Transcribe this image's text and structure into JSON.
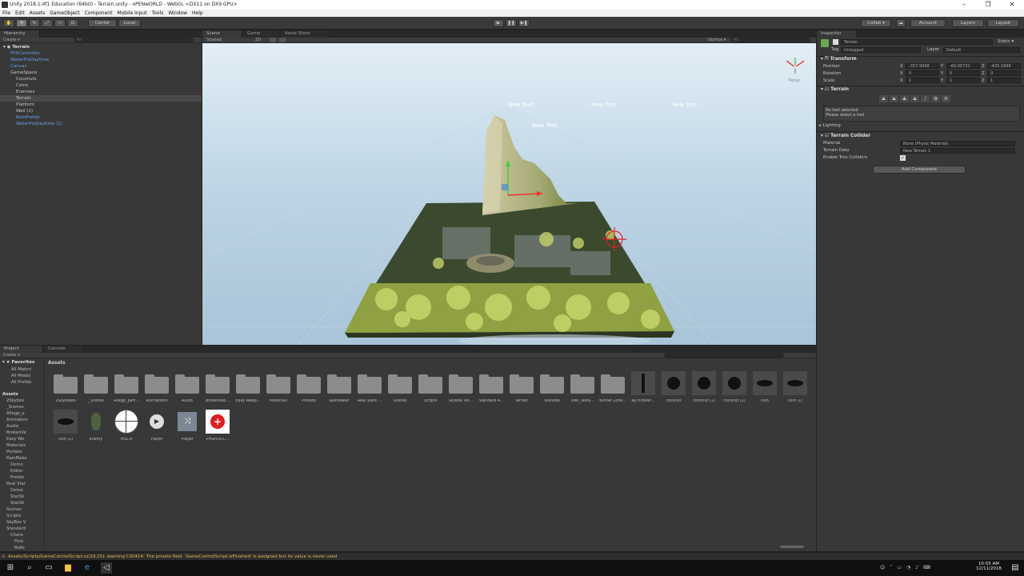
{
  "window": {
    "title": "Unity 2018.1.4f1 Education (64bit) - Terrain.unity - oPENwORLD - WebGL <DX11 on DX9 GPU>",
    "minimize": "–",
    "maximize": "❐",
    "close": "✕"
  },
  "menu": [
    "File",
    "Edit",
    "Assets",
    "GameObject",
    "Component",
    "Mobile Input",
    "Tools",
    "Window",
    "Help"
  ],
  "toolbar": {
    "center": "Center",
    "local": "Local",
    "collab": "Collab ▾",
    "account": "Account",
    "layers": "Layers",
    "layout": "Layout"
  },
  "hierarchy": {
    "tab": "Hierarchy",
    "create": "Create ▾",
    "search": "All",
    "scene": "Terrain",
    "items": [
      {
        "label": "FPSController",
        "indent": 1,
        "blue": true
      },
      {
        "label": "WaterProDaytime",
        "indent": 1,
        "blue": true
      },
      {
        "label": "Canvas",
        "indent": 1,
        "blue": true
      },
      {
        "label": "GameSpace",
        "indent": 1,
        "blue": false
      },
      {
        "label": "Coconuts",
        "indent": 2,
        "blue": false
      },
      {
        "label": "Coins",
        "indent": 2,
        "blue": false
      },
      {
        "label": "Enemies",
        "indent": 2,
        "blue": false
      },
      {
        "label": "Terrain",
        "indent": 2,
        "blue": false,
        "selected": true
      },
      {
        "label": "Platform",
        "indent": 2,
        "blue": false
      },
      {
        "label": "Wall (1)",
        "indent": 2,
        "blue": false
      },
      {
        "label": "RainPrefab",
        "indent": 2,
        "blue": true
      },
      {
        "label": "WaterProDaytime (1)",
        "indent": 2,
        "blue": true
      }
    ]
  },
  "scene": {
    "tabs": [
      "Scene",
      "Game",
      "Asset Store"
    ],
    "shading": "Shaded",
    "mode2d": "2D",
    "gizmos": "Gizmos ▾",
    "search": "All",
    "persp": "Persp",
    "texts": [
      "New Text",
      "New Text",
      "New Text",
      "New Text"
    ]
  },
  "inspector": {
    "tab": "Inspector",
    "object": "Terrain",
    "static": "Static ▾",
    "tag_label": "Tag",
    "tag": "Untagged",
    "layer_label": "Layer",
    "layer": "Default",
    "transform": {
      "title": "Transform",
      "rows": [
        {
          "label": "Position",
          "x": "-357.9068",
          "y": "-60.00732",
          "z": "-425.1698"
        },
        {
          "label": "Rotation",
          "x": "0",
          "y": "0",
          "z": "0"
        },
        {
          "label": "Scale",
          "x": "1",
          "y": "1",
          "z": "1"
        }
      ]
    },
    "terrain": {
      "title": "Terrain",
      "no_tool": "No tool selected",
      "select_tool": "Please select a tool",
      "lighting": "Lighting"
    },
    "collider": {
      "title": "Terrain Collider",
      "material_label": "Material",
      "material": "None (Physic Material)",
      "data_label": "Terrain Data",
      "data": "New Terrain 1",
      "trees_label": "Enable Tree Colliders"
    },
    "add_component": "Add Component"
  },
  "project": {
    "tabs": [
      "Project",
      "Console"
    ],
    "create": "Create ▾",
    "favorites": "Favorites",
    "fav_items": [
      "All Materi",
      "All Model",
      "All Prefab"
    ],
    "assets_header": "Assets",
    "breadcrumb": "Assets",
    "tree": [
      "Assets",
      "2Skybox",
      "_Scenes",
      "Allegp_p",
      "Animation",
      "Audio",
      "BrokenVe",
      "Easy We",
      "Materials",
      "Prefabs",
      "RainMake",
      "Demo",
      "Editor",
      "Prefab",
      "Real Star",
      "Demo",
      "StarSk",
      "StarSk",
      "Scenes",
      "Scripts",
      "SkyBox V",
      "Standard",
      "Chara",
      "First",
      "Rolle"
    ],
    "row1": [
      "2Skyboxes",
      "_Scenes",
      "Allegp_part...",
      "Animations",
      "Audio",
      "BrokenVec...",
      "Easy Weap...",
      "Materials",
      "Prefabs",
      "RainMaker",
      "Real Stars ...",
      "Scenes",
      "Scripts",
      "SkyBox Vol...",
      "Standard A...",
      "Terrain",
      "Textures",
      "Tree_Textu...",
      "Winter Zone...",
      "AJThirdPer...",
      "coconut",
      "coconut (1)",
      "coconut (2)",
      "coin",
      "coin (1)"
    ],
    "row2": [
      "coin (2)",
      "Enemy",
      "MSL-8",
      "Player",
      "Player",
      "PHSPDX-C..."
    ]
  },
  "status": "Assets/Scripts/GameControlScript.cs(29,15): warning CS0414: The private field `GameControlScript.isFinished' is assigned but its value is never used",
  "taskbar": {
    "time": "10:55 AM",
    "date": "12/11/2018"
  }
}
